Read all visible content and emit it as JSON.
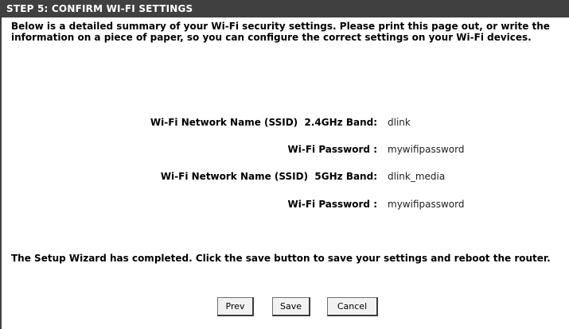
{
  "header": {
    "title": "STEP 5: CONFIRM WI-FI SETTINGS"
  },
  "intro": "Below is a detailed summary of your Wi-Fi security settings. Please print this page out, or write the information on a piece of paper, so you can configure the correct settings on your Wi-Fi devices.",
  "settings": [
    {
      "label": "Wi-Fi Network Name (SSID)  2.4GHz Band:",
      "value": "dlink"
    },
    {
      "label": "Wi-Fi Password :",
      "value": "mywifipassword"
    },
    {
      "label": "Wi-Fi Network Name (SSID)  5GHz Band:",
      "value": "dlink_media"
    },
    {
      "label": "Wi-Fi Password :",
      "value": "mywifipassword"
    }
  ],
  "outro": "The Setup Wizard has completed. Click the save button to save your settings and reboot the router.",
  "buttons": {
    "prev": "Prev",
    "save": "Save",
    "cancel": "Cancel"
  }
}
